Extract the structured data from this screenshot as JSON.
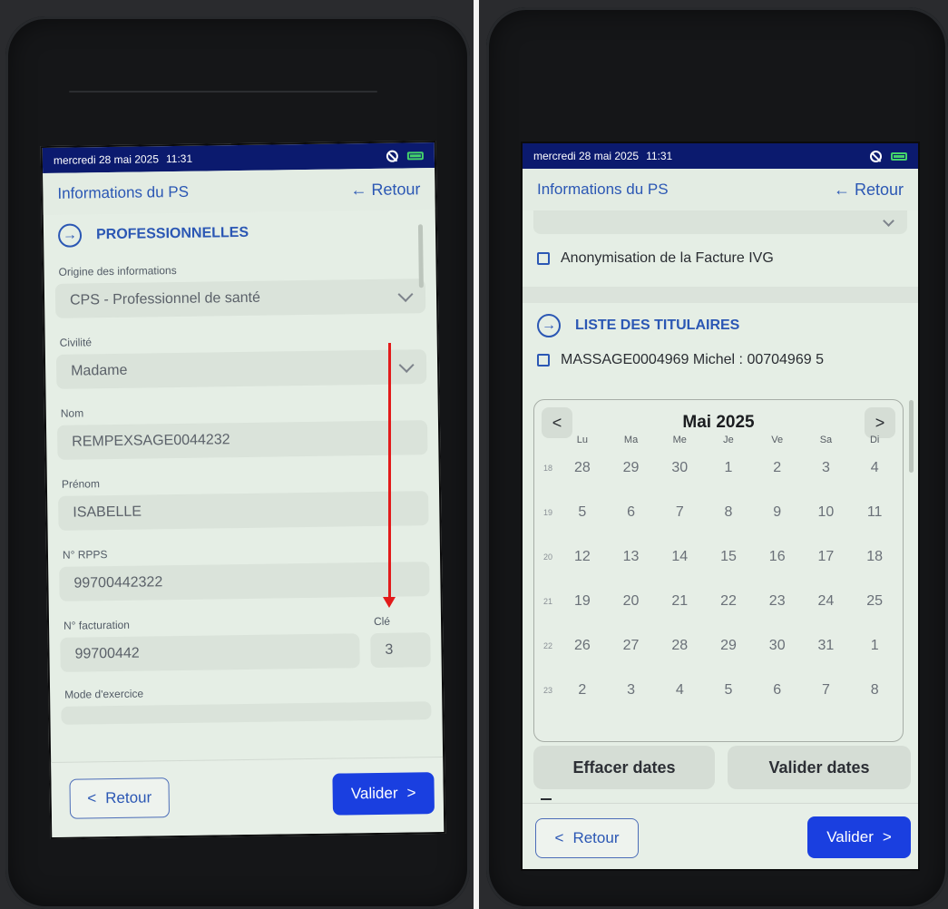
{
  "left": {
    "status": {
      "date": "mercredi 28 mai 2025",
      "time": "11:31"
    },
    "topbar": {
      "title": "Informations du PS",
      "back_label": "← Retour"
    },
    "section": {
      "title": "PROFESSIONNELLES"
    },
    "fields": {
      "origine_label": "Origine des informations",
      "origine_value": "CPS - Professionnel de santé",
      "civilite_label": "Civilité",
      "civilite_value": "Madame",
      "nom_label": "Nom",
      "nom_value": "REMPEXSAGE0044232",
      "prenom_label": "Prénom",
      "prenom_value": "ISABELLE",
      "rpps_label": "N° RPPS",
      "rpps_value": "99700442322",
      "facturation_label": "N° facturation",
      "facturation_value": "99700442",
      "cle_label": "Clé",
      "cle_value": "3",
      "mode_label": "Mode d'exercice"
    },
    "footer": {
      "back_label": "Retour",
      "validate_label": "Valider"
    }
  },
  "right": {
    "status": {
      "date": "mercredi 28 mai 2025",
      "time": "11:31"
    },
    "topbar": {
      "title": "Informations du PS",
      "back_label": "← Retour"
    },
    "anonymisation_label": "Anonymisation de la Facture IVG",
    "section": {
      "title": "LISTE DES TITULAIRES"
    },
    "titulaire_label": "MASSAGE0004969 Michel : 00704969 5",
    "calendar": {
      "title": "Mai 2025",
      "prev": "<",
      "next": ">",
      "weekdays": [
        "Lu",
        "Ma",
        "Me",
        "Je",
        "Ve",
        "Sa",
        "Di"
      ],
      "weeks": [
        {
          "num": "18",
          "days": [
            "28",
            "29",
            "30",
            "1",
            "2",
            "3",
            "4"
          ]
        },
        {
          "num": "19",
          "days": [
            "5",
            "6",
            "7",
            "8",
            "9",
            "10",
            "11"
          ]
        },
        {
          "num": "20",
          "days": [
            "12",
            "13",
            "14",
            "15",
            "16",
            "17",
            "18"
          ]
        },
        {
          "num": "21",
          "days": [
            "19",
            "20",
            "21",
            "22",
            "23",
            "24",
            "25"
          ]
        },
        {
          "num": "22",
          "days": [
            "26",
            "27",
            "28",
            "29",
            "30",
            "31",
            "1"
          ]
        },
        {
          "num": "23",
          "days": [
            "2",
            "3",
            "4",
            "5",
            "6",
            "7",
            "8"
          ]
        }
      ]
    },
    "clear_dates_label": "Effacer dates",
    "validate_dates_label": "Valider dates",
    "footer": {
      "back_label": "Retour",
      "validate_label": "Valider"
    }
  },
  "colors": {
    "status_bar": "#0b1a6e",
    "accent": "#2b57b4",
    "primary_button": "#1a3fe0",
    "screen_bg": "#e5eee5",
    "annotation_arrow": "#e21a1a"
  }
}
